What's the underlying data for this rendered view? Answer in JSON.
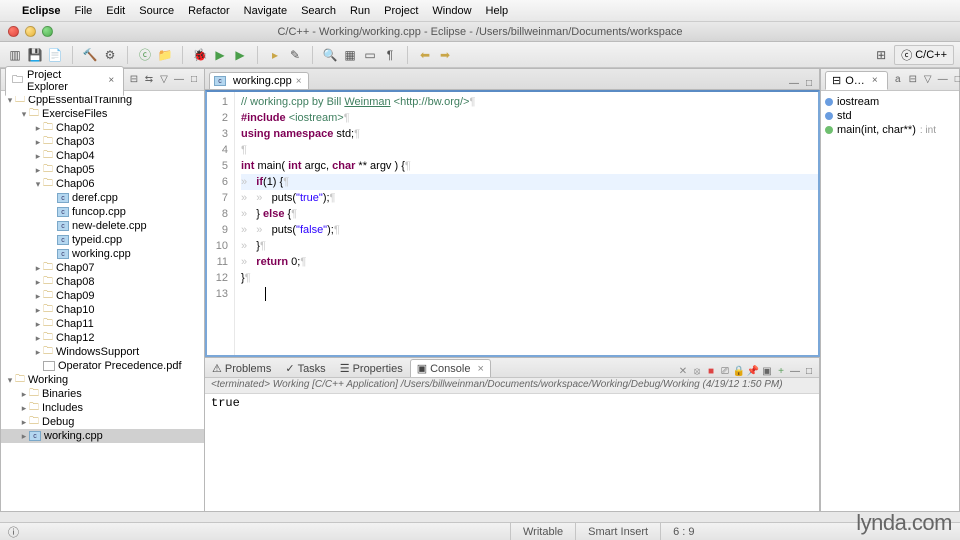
{
  "menubar": {
    "apple": "",
    "app": "Eclipse",
    "items": [
      "File",
      "Edit",
      "Source",
      "Refactor",
      "Navigate",
      "Search",
      "Run",
      "Project",
      "Window",
      "Help"
    ]
  },
  "window": {
    "title": "C/C++ - Working/working.cpp - Eclipse - /Users/billweinman/Documents/workspace"
  },
  "perspective": {
    "label": "C/C++"
  },
  "projectExplorer": {
    "title": "Project Explorer",
    "tree": [
      {
        "d": 0,
        "exp": "▾",
        "icon": "folder",
        "label": "CppEssentialTraining"
      },
      {
        "d": 1,
        "exp": "▾",
        "icon": "folder",
        "label": "ExerciseFiles"
      },
      {
        "d": 2,
        "exp": "▸",
        "icon": "folder",
        "label": "Chap02"
      },
      {
        "d": 2,
        "exp": "▸",
        "icon": "folder",
        "label": "Chap03"
      },
      {
        "d": 2,
        "exp": "▸",
        "icon": "folder",
        "label": "Chap04"
      },
      {
        "d": 2,
        "exp": "▸",
        "icon": "folder",
        "label": "Chap05"
      },
      {
        "d": 2,
        "exp": "▾",
        "icon": "folder",
        "label": "Chap06"
      },
      {
        "d": 3,
        "exp": "",
        "icon": "c",
        "label": "deref.cpp"
      },
      {
        "d": 3,
        "exp": "",
        "icon": "c",
        "label": "funcop.cpp"
      },
      {
        "d": 3,
        "exp": "",
        "icon": "c",
        "label": "new-delete.cpp"
      },
      {
        "d": 3,
        "exp": "",
        "icon": "c",
        "label": "typeid.cpp"
      },
      {
        "d": 3,
        "exp": "",
        "icon": "c",
        "label": "working.cpp"
      },
      {
        "d": 2,
        "exp": "▸",
        "icon": "folder",
        "label": "Chap07"
      },
      {
        "d": 2,
        "exp": "▸",
        "icon": "folder",
        "label": "Chap08"
      },
      {
        "d": 2,
        "exp": "▸",
        "icon": "folder",
        "label": "Chap09"
      },
      {
        "d": 2,
        "exp": "▸",
        "icon": "folder",
        "label": "Chap10"
      },
      {
        "d": 2,
        "exp": "▸",
        "icon": "folder",
        "label": "Chap11"
      },
      {
        "d": 2,
        "exp": "▸",
        "icon": "folder",
        "label": "Chap12"
      },
      {
        "d": 2,
        "exp": "▸",
        "icon": "folder",
        "label": "WindowsSupport"
      },
      {
        "d": 2,
        "exp": "",
        "icon": "pdf",
        "label": "Operator Precedence.pdf"
      },
      {
        "d": 0,
        "exp": "▾",
        "icon": "folder",
        "label": "Working"
      },
      {
        "d": 1,
        "exp": "▸",
        "icon": "folder",
        "label": "Binaries"
      },
      {
        "d": 1,
        "exp": "▸",
        "icon": "folder",
        "label": "Includes"
      },
      {
        "d": 1,
        "exp": "▸",
        "icon": "folder",
        "label": "Debug"
      },
      {
        "d": 1,
        "exp": "▸",
        "icon": "c",
        "label": "working.cpp",
        "sel": true
      }
    ]
  },
  "editor": {
    "tab": "working.cpp",
    "lines": [
      {
        "n": 1,
        "tokens": [
          [
            "c-comment",
            "// working.cpp by Bill "
          ],
          [
            "c-link",
            "Weinman"
          ],
          [
            "c-comment",
            " <http://bw.org/>"
          ],
          [
            "c-ws",
            "¶"
          ]
        ]
      },
      {
        "n": 2,
        "tokens": [
          [
            "c-pre",
            "#include "
          ],
          [
            "c-comment",
            "<iostream>"
          ],
          [
            "c-ws",
            "¶"
          ]
        ]
      },
      {
        "n": 3,
        "tokens": [
          [
            "c-kw",
            "using "
          ],
          [
            "c-kw",
            "namespace"
          ],
          [
            "",
            " std;"
          ],
          [
            "c-ws",
            "¶"
          ]
        ]
      },
      {
        "n": 4,
        "tokens": [
          [
            "c-ws",
            "¶"
          ]
        ]
      },
      {
        "n": 5,
        "tokens": [
          [
            "c-kw",
            "int"
          ],
          [
            "",
            " main( "
          ],
          [
            "c-kw",
            "int"
          ],
          [
            "",
            " argc, "
          ],
          [
            "c-kw",
            "char"
          ],
          [
            "",
            " ** argv ) {"
          ],
          [
            "c-ws",
            "¶"
          ]
        ]
      },
      {
        "n": 6,
        "hl": true,
        "tokens": [
          [
            "c-ws",
            "»   "
          ],
          [
            "c-kw",
            "if"
          ],
          [
            "",
            "(1) {"
          ],
          [
            "c-ws",
            "¶"
          ]
        ]
      },
      {
        "n": 7,
        "tokens": [
          [
            "c-ws",
            "»   »   "
          ],
          [
            "",
            "puts("
          ],
          [
            "c-str",
            "\"true\""
          ],
          [
            "",
            ");"
          ],
          [
            "c-ws",
            "¶"
          ]
        ]
      },
      {
        "n": 8,
        "tokens": [
          [
            "c-ws",
            "»   "
          ],
          [
            "",
            "} "
          ],
          [
            "c-kw",
            "else"
          ],
          [
            "",
            " {"
          ],
          [
            "c-ws",
            "¶"
          ]
        ]
      },
      {
        "n": 9,
        "tokens": [
          [
            "c-ws",
            "»   »   "
          ],
          [
            "",
            "puts("
          ],
          [
            "c-str",
            "\"false\""
          ],
          [
            "",
            ");"
          ],
          [
            "c-ws",
            "¶"
          ]
        ]
      },
      {
        "n": 10,
        "tokens": [
          [
            "c-ws",
            "»   "
          ],
          [
            "",
            "}"
          ],
          [
            "c-ws",
            "¶"
          ]
        ]
      },
      {
        "n": 11,
        "tokens": [
          [
            "c-ws",
            "»   "
          ],
          [
            "c-kw",
            "return"
          ],
          [
            "",
            " 0;"
          ],
          [
            "c-ws",
            "¶"
          ]
        ]
      },
      {
        "n": 12,
        "tokens": [
          [
            "",
            "}"
          ],
          [
            "c-ws",
            "¶"
          ]
        ]
      },
      {
        "n": 13,
        "tokens": [
          [
            "",
            "        "
          ],
          [
            "cursor",
            ""
          ]
        ]
      }
    ]
  },
  "outline": {
    "title": "O…",
    "items": [
      {
        "color": "blue",
        "label": "iostream"
      },
      {
        "color": "blue",
        "label": "std"
      },
      {
        "color": "green",
        "label": "main(int, char**)",
        "type": ": int"
      }
    ]
  },
  "bottomTabs": {
    "problems": "Problems",
    "tasks": "Tasks",
    "properties": "Properties",
    "console": "Console"
  },
  "console": {
    "header": "<terminated> Working [C/C++ Application] /Users/billweinman/Documents/workspace/Working/Debug/Working (4/19/12 1:50 PM)",
    "output": "true"
  },
  "status": {
    "writable": "Writable",
    "insert": "Smart Insert",
    "pos": "6 : 9"
  },
  "watermark": "lynda.com"
}
